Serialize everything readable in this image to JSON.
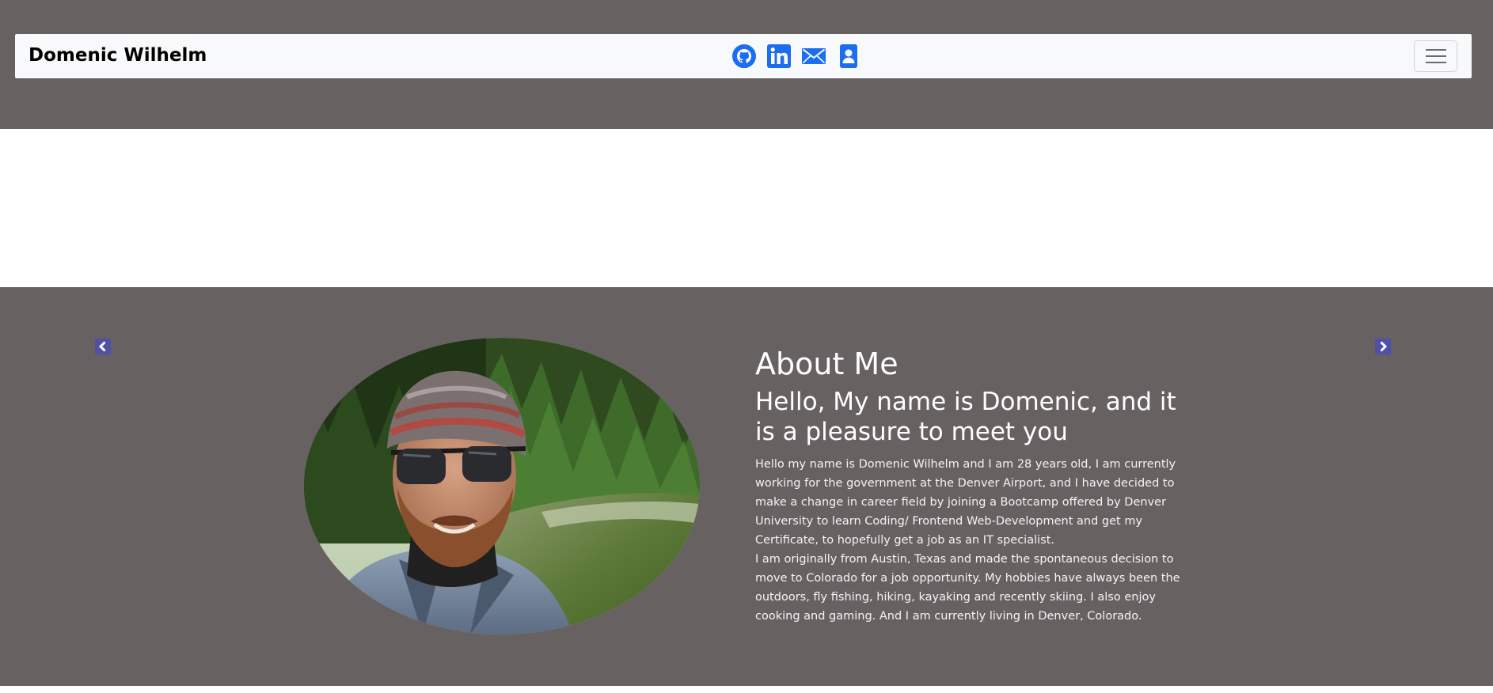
{
  "navbar": {
    "brand": "Domenic Wilhelm",
    "icons": [
      {
        "name": "github-icon",
        "color": "#1b6ef0"
      },
      {
        "name": "linkedin-icon",
        "color": "#1b6ef0"
      },
      {
        "name": "envelope-icon",
        "color": "#1b6ef0"
      },
      {
        "name": "contact-card-icon",
        "color": "#1b6ef0"
      }
    ],
    "toggler_icon": "hamburger-icon"
  },
  "carousel": {
    "prev_icon": "chevron-left-icon",
    "next_icon": "chevron-right-icon"
  },
  "about": {
    "title": "About Me",
    "subtitle": "Hello, My name is Domenic, and it is a pleasure to meet you",
    "paragraph1": "Hello my name is Domenic Wilhelm and I am 28 years old, I am currently working for the government at the Denver Airport, and I have decided to make a change in career field by joining a Bootcamp offered by Denver University to learn Coding/ Frontend Web-Development and get my Certificate, to hopefully get a job as an IT specialist.",
    "paragraph2": "I am originally from Austin, Texas and made the spontaneous decision to move to Colorado for a job opportunity. My hobbies have always been the outdoors, fly fishing, hiking, kayaking and recently skiing. I also enjoy cooking and gaming. And I am currently living in Denver, Colorado."
  },
  "colors": {
    "page_background": "#676162",
    "navbar_background": "#f8f9fa",
    "icon_blue": "#1b6ef0",
    "carousel_control": "#5050a8"
  }
}
